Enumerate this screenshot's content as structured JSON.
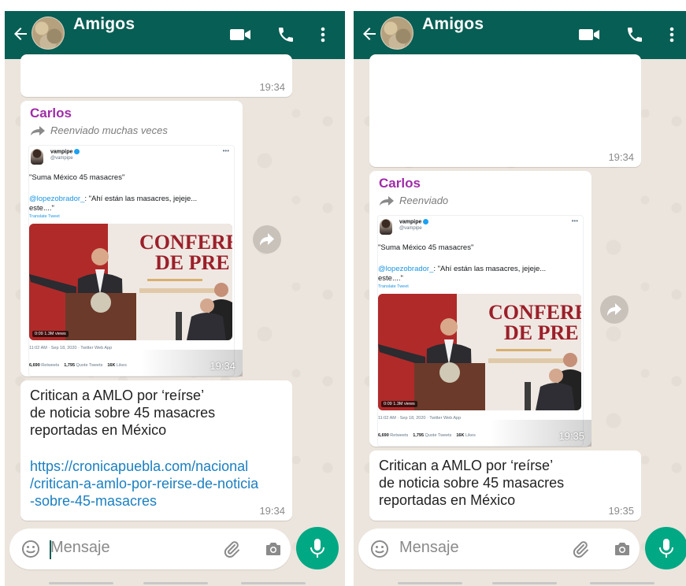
{
  "panels": [
    {
      "header": {
        "title": "Amigos"
      },
      "prev_time": "19:34",
      "forwarded": {
        "sender": "Carlos",
        "label": "Reenviado muchas veces",
        "time": "19:34"
      },
      "link_message": {
        "text_lines": [
          "Critican a AMLO por ‘reírse’",
          "de noticia sobre 45 masacres",
          "reportadas en México"
        ],
        "link_lines": [
          "https://cronicapuebla.com/nacional",
          "/critican-a-amlo-por-reirse-de-noticia",
          "-sobre-45-masacres"
        ],
        "time": "19:34"
      },
      "composer": {
        "placeholder": "Mensaje"
      }
    },
    {
      "header": {
        "title": "Amigos"
      },
      "prev_time": "19:34",
      "forwarded": {
        "sender": "Carlos",
        "label": "Reenviado",
        "time": "19:35"
      },
      "link_message": {
        "text_lines": [
          "Critican a AMLO por ‘reírse’",
          "de noticia sobre 45 masacres",
          "reportadas en México"
        ],
        "time": "19:35"
      },
      "composer": {
        "placeholder": "Mensaje"
      }
    }
  ],
  "tweet": {
    "name": "vampipe",
    "handle": "@vampipe",
    "text": "\"Suma México 45 masacres\"",
    "mention": "@lopezobrador_",
    "reply_line1": ": \"Ahí están las masacres, jejeje...",
    "reply_line2": "este....\"",
    "translate": "Translate Tweet",
    "media_title1": "CONFERE",
    "media_title2": "DE PRE",
    "views": "0:09 1.3M views",
    "date": "11:02 AM · Sep 18, 2020 · Twitter Web App",
    "retweets": "6,690",
    "retweets_label": "Retweets",
    "quotes": "1,795",
    "quotes_label": "Quote Tweets",
    "likes": "16K",
    "likes_label": "Likes"
  },
  "colors": {
    "header": "#075e54",
    "sender": "#a02ca8",
    "link": "#1a7fc1",
    "mic": "#00a884",
    "wallpaper": "#ece5dd"
  },
  "icons": [
    "back-arrow-icon",
    "video-call-icon",
    "phone-icon",
    "more-vert-icon",
    "forward-arrow-icon",
    "emoji-icon",
    "attach-icon",
    "camera-icon",
    "mic-icon"
  ]
}
